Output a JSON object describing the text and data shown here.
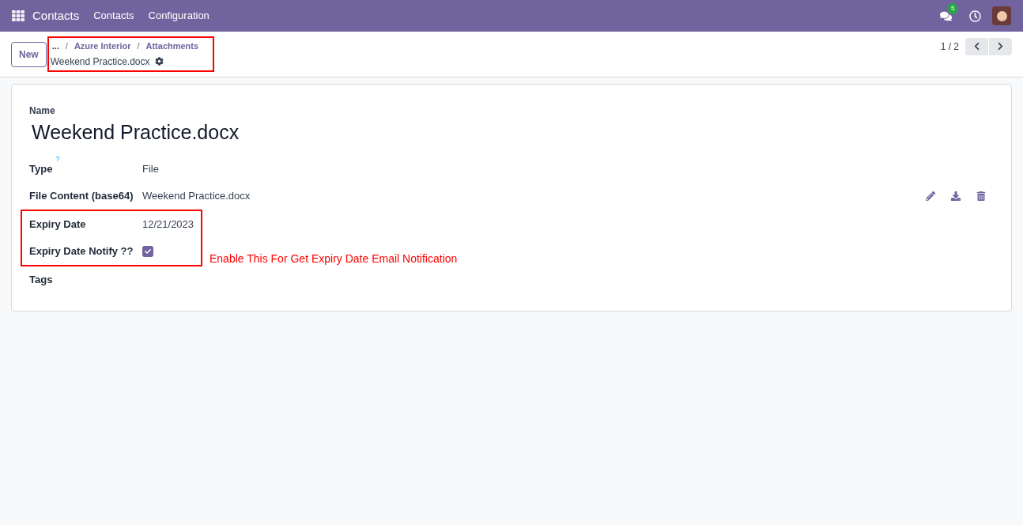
{
  "navbar": {
    "app_name": "Contacts",
    "menu": [
      "Contacts",
      "Configuration"
    ],
    "messages_badge": "5"
  },
  "control_panel": {
    "new_button": "New",
    "breadcrumbs": [
      "...",
      "Azure Interior",
      "Attachments"
    ],
    "breadcrumb_separator": "/",
    "record_title": "Weekend Practice.docx",
    "pager": "1 / 2"
  },
  "form": {
    "name_label": "Name",
    "name": "Weekend Practice.docx",
    "fields": [
      {
        "kind": "text",
        "label": "Type",
        "help": "?",
        "value": "File",
        "highlighted": false
      },
      {
        "kind": "file",
        "label": "File Content (base64)",
        "value": "Weekend Practice.docx",
        "highlighted": false
      },
      {
        "kind": "text",
        "label": "Expiry Date",
        "value": "12/21/2023",
        "highlighted": true
      },
      {
        "kind": "checkbox",
        "label": "Expiry Date Notify ??",
        "checked": true,
        "highlighted": true
      },
      {
        "kind": "text",
        "label": "Tags",
        "highlighted": false
      }
    ]
  },
  "annotation": "Enable This For Get Expiry Date Email Notification"
}
